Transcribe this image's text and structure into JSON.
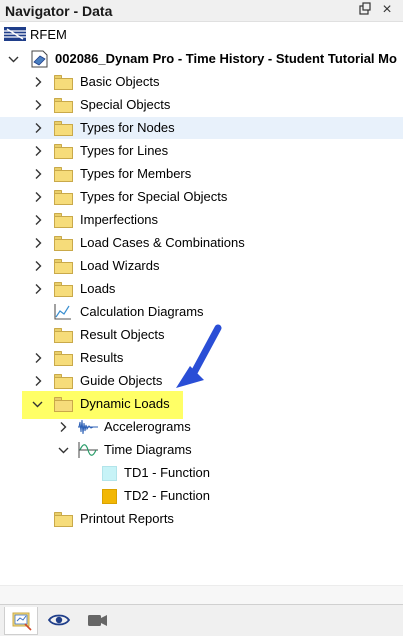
{
  "window": {
    "title": "Navigator - Data"
  },
  "tree": {
    "root": "RFEM",
    "model": "002086_Dynam Pro - Time History - Student Tutorial Mo",
    "items": [
      "Basic Objects",
      "Special Objects",
      "Types for Nodes",
      "Types for Lines",
      "Types for Members",
      "Types for Special Objects",
      "Imperfections",
      "Load Cases & Combinations",
      "Load Wizards",
      "Loads",
      "Calculation Diagrams",
      "Result Objects",
      "Results",
      "Guide Objects",
      "Dynamic Loads",
      "Printout Reports"
    ],
    "dynamic": {
      "accelerograms": "Accelerograms",
      "time_diagrams": "Time Diagrams",
      "td1": "TD1 - Function",
      "td2": "TD2 - Function"
    }
  },
  "colors": {
    "highlight": "#ffff66",
    "arrow": "#2a4ed6",
    "td1": "#c7f3f7",
    "td2": "#f2b705",
    "selected_row": "#e8f1fb"
  },
  "icons": {
    "pin": "pin-icon",
    "close": "close-icon",
    "data_tab": "data-navigator-icon",
    "view_tab": "eye-icon",
    "video_tab": "video-camera-icon"
  }
}
